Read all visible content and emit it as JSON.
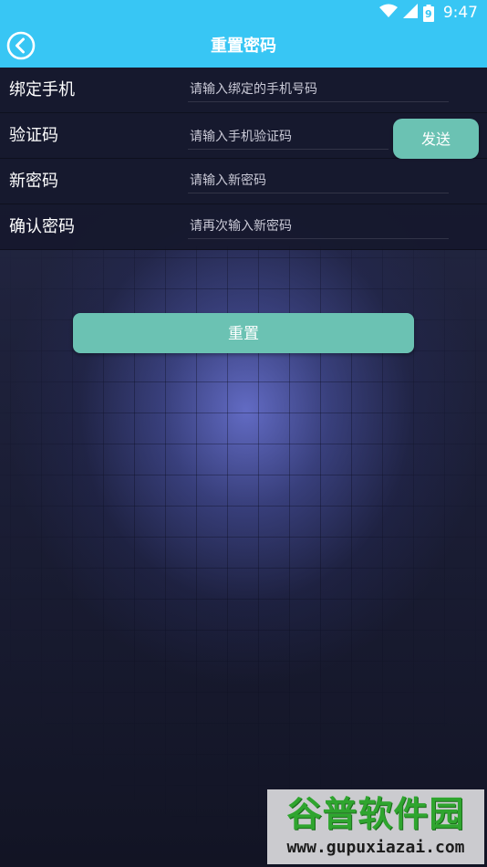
{
  "status_bar": {
    "time": "9:47",
    "battery_level": "9",
    "icons": [
      "wifi-icon",
      "signal-icon",
      "battery-icon"
    ],
    "color": "#38c6f4"
  },
  "header": {
    "title": "重置密码",
    "back_icon": "back-arrow-icon",
    "color": "#38c6f4"
  },
  "form": {
    "rows": [
      {
        "label": "绑定手机",
        "placeholder": "请输入绑定的手机号码"
      },
      {
        "label": "验证码",
        "placeholder": "请输入手机验证码",
        "action_label": "发送"
      },
      {
        "label": "新密码",
        "placeholder": "请输入新密码"
      },
      {
        "label": "确认密码",
        "placeholder": "请再次输入新密码"
      }
    ]
  },
  "reset_button": {
    "label": "重置",
    "color": "#6bc2b3"
  },
  "watermark": {
    "title": "谷普软件园",
    "url": "www.gupuxiazai.com"
  }
}
